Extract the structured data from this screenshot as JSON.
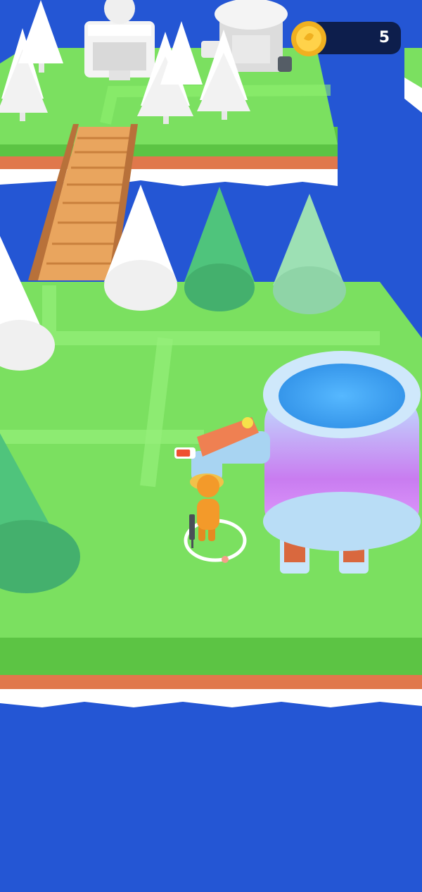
{
  "hud": {
    "coin_count": "5",
    "coin_icon": "gold-coin-icon"
  },
  "player": {
    "health_fraction": 0.8
  },
  "colors": {
    "water": "#2456d4",
    "grass": "#7be060",
    "island_edge": "#e0784c",
    "snow_tree": "#ffffff",
    "green_tree": "#4fc47c",
    "coin_bar": "#0d1e4c",
    "player": "#f39a2a",
    "tank_water": "#3fa5f0"
  }
}
